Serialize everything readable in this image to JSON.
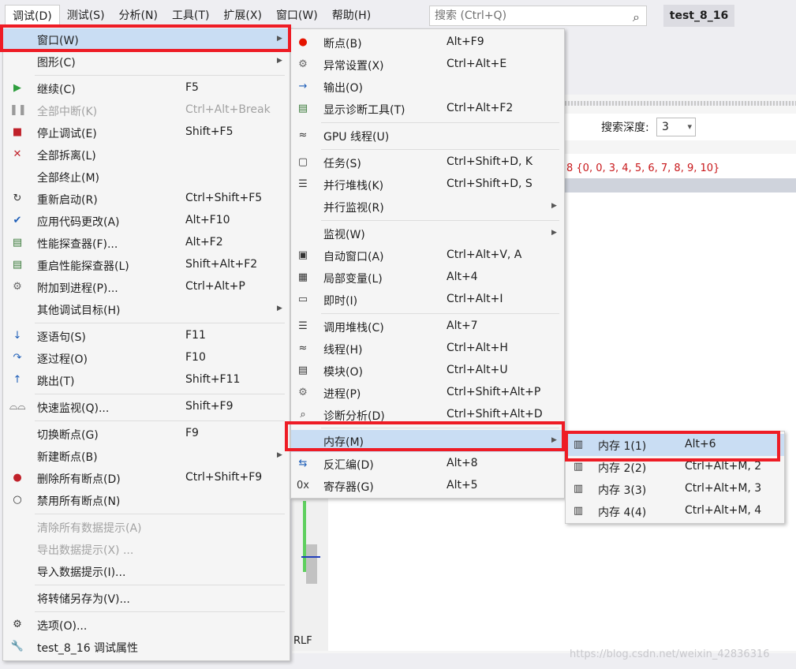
{
  "menubar": {
    "items": [
      "调试(D)",
      "测试(S)",
      "分析(N)",
      "工具(T)",
      "扩展(X)",
      "窗口(W)",
      "帮助(H)"
    ],
    "search_placeholder": "搜索 (Ctrl+Q)",
    "solution_title": "test_8_16"
  },
  "background": {
    "search_depth_label": "搜索深度:",
    "search_depth_value": "3",
    "array_text": "8 {0, 0, 3, 4, 5, 6, 7, 8, 9, 10}",
    "crlf": "RLF",
    "watermark": "https://blog.csdn.net/weixin_42836316"
  },
  "debug_menu": [
    {
      "label": "窗口(W)",
      "shortcut": "",
      "icon": "none",
      "submenu": true,
      "highlight": true
    },
    {
      "label": "图形(C)",
      "shortcut": "",
      "icon": "none",
      "submenu": true
    },
    {
      "label": "继续(C)",
      "shortcut": "F5",
      "icon": "play-icon"
    },
    {
      "label": "全部中断(K)",
      "shortcut": "Ctrl+Alt+Break",
      "icon": "pause-icon",
      "disabled": true
    },
    {
      "label": "停止调试(E)",
      "shortcut": "Shift+F5",
      "icon": "stop-icon"
    },
    {
      "label": "全部拆离(L)",
      "shortcut": "",
      "icon": "detach-x-icon"
    },
    {
      "label": "全部终止(M)",
      "shortcut": "",
      "icon": "none"
    },
    {
      "label": "重新启动(R)",
      "shortcut": "Ctrl+Shift+F5",
      "icon": "restart-icon"
    },
    {
      "label": "应用代码更改(A)",
      "shortcut": "Alt+F10",
      "icon": "apply-code-changes-icon"
    },
    {
      "label": "性能探查器(F)...",
      "shortcut": "Alt+F2",
      "icon": "performance-profiler-icon"
    },
    {
      "label": "重启性能探查器(L)",
      "shortcut": "Shift+Alt+F2",
      "icon": "relaunch-profiler-icon"
    },
    {
      "label": "附加到进程(P)...",
      "shortcut": "Ctrl+Alt+P",
      "icon": "attach-process-icon"
    },
    {
      "label": "其他调试目标(H)",
      "shortcut": "",
      "icon": "none",
      "submenu": true
    },
    {
      "label": "逐语句(S)",
      "shortcut": "F11",
      "icon": "step-into-icon"
    },
    {
      "label": "逐过程(O)",
      "shortcut": "F10",
      "icon": "step-over-icon"
    },
    {
      "label": "跳出(T)",
      "shortcut": "Shift+F11",
      "icon": "step-out-icon"
    },
    {
      "label": "快速监视(Q)...",
      "shortcut": "Shift+F9",
      "icon": "quickwatch-glasses-icon"
    },
    {
      "label": "切换断点(G)",
      "shortcut": "F9",
      "icon": "none"
    },
    {
      "label": "新建断点(B)",
      "shortcut": "",
      "icon": "none",
      "submenu": true
    },
    {
      "label": "删除所有断点(D)",
      "shortcut": "Ctrl+Shift+F9",
      "icon": "delete-breakpoints-icon"
    },
    {
      "label": "禁用所有断点(N)",
      "shortcut": "",
      "icon": "disable-breakpoints-icon"
    },
    {
      "label": "清除所有数据提示(A)",
      "shortcut": "",
      "icon": "none",
      "disabled": true
    },
    {
      "label": "导出数据提示(X) ...",
      "shortcut": "",
      "icon": "none",
      "disabled": true
    },
    {
      "label": "导入数据提示(I)...",
      "shortcut": "",
      "icon": "none"
    },
    {
      "label": "将转储另存为(V)...",
      "shortcut": "",
      "icon": "none"
    },
    {
      "label": "选项(O)...",
      "shortcut": "",
      "icon": "gear-icon"
    },
    {
      "label": "test_8_16 调试属性",
      "shortcut": "",
      "icon": "wrench-icon"
    }
  ],
  "window_menu": [
    {
      "label": "断点(B)",
      "shortcut": "Alt+F9",
      "icon": "breakpoint-icon"
    },
    {
      "label": "异常设置(X)",
      "shortcut": "Ctrl+Alt+E",
      "icon": "exception-settings-icon"
    },
    {
      "label": "输出(O)",
      "shortcut": "",
      "icon": "output-icon"
    },
    {
      "label": "显示诊断工具(T)",
      "shortcut": "Ctrl+Alt+F2",
      "icon": "diagnostic-tools-icon"
    },
    {
      "label": "GPU 线程(U)",
      "shortcut": "",
      "icon": "gpu-threads-icon"
    },
    {
      "label": "任务(S)",
      "shortcut": "Ctrl+Shift+D, K",
      "icon": "tasks-icon"
    },
    {
      "label": "并行堆栈(K)",
      "shortcut": "Ctrl+Shift+D, S",
      "icon": "parallel-stacks-icon"
    },
    {
      "label": "并行监视(R)",
      "shortcut": "",
      "icon": "none",
      "submenu": true
    },
    {
      "label": "监视(W)",
      "shortcut": "",
      "icon": "none",
      "submenu": true
    },
    {
      "label": "自动窗口(A)",
      "shortcut": "Ctrl+Alt+V, A",
      "icon": "autos-icon"
    },
    {
      "label": "局部变量(L)",
      "shortcut": "Alt+4",
      "icon": "locals-icon"
    },
    {
      "label": "即时(I)",
      "shortcut": "Ctrl+Alt+I",
      "icon": "immediate-icon"
    },
    {
      "label": "调用堆栈(C)",
      "shortcut": "Alt+7",
      "icon": "call-stack-icon"
    },
    {
      "label": "线程(H)",
      "shortcut": "Ctrl+Alt+H",
      "icon": "threads-icon"
    },
    {
      "label": "模块(O)",
      "shortcut": "Ctrl+Alt+U",
      "icon": "modules-icon"
    },
    {
      "label": "进程(P)",
      "shortcut": "Ctrl+Shift+Alt+P",
      "icon": "processes-icon"
    },
    {
      "label": "诊断分析(D)",
      "shortcut": "Ctrl+Shift+Alt+D",
      "icon": "diagnostic-analysis-icon"
    },
    {
      "label": "内存(M)",
      "shortcut": "",
      "icon": "none",
      "submenu": true,
      "highlight": true
    },
    {
      "label": "反汇编(D)",
      "shortcut": "Alt+8",
      "icon": "disassembly-icon"
    },
    {
      "label": "寄存器(G)",
      "shortcut": "Alt+5",
      "icon": "registers-icon"
    }
  ],
  "memory_menu": [
    {
      "label": "内存 1(1)",
      "shortcut": "Alt+6",
      "icon": "memory-chip-icon",
      "highlight": true
    },
    {
      "label": "内存 2(2)",
      "shortcut": "Ctrl+Alt+M, 2",
      "icon": "memory-chip-icon"
    },
    {
      "label": "内存 3(3)",
      "shortcut": "Ctrl+Alt+M, 3",
      "icon": "memory-chip-icon"
    },
    {
      "label": "内存 4(4)",
      "shortcut": "Ctrl+Alt+M, 4",
      "icon": "memory-chip-icon"
    }
  ],
  "colors": {
    "highlight": "#c9ddf3",
    "annotation_red": "#ee1c25",
    "disabled_text": "#a2a2a2"
  }
}
